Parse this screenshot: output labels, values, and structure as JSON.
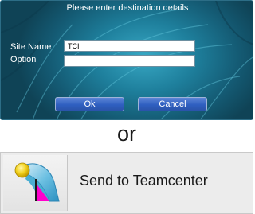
{
  "dialog": {
    "title": "Please enter destination details",
    "site_name_label": "Site Name",
    "site_name_value": "TCI",
    "option_label": "Option",
    "option_value": "",
    "ok_label": "Ok",
    "cancel_label": "Cancel"
  },
  "separator_text": "or",
  "teamcenter_button": {
    "label": "Send to Teamcenter",
    "icon": "send-to-teamcenter-icon"
  },
  "colors": {
    "dialog_background": "#1e7f9c",
    "button_blue": "#2f5fc0",
    "icon_magenta": "#ff00cc",
    "icon_yellow": "#f2d21e",
    "icon_teal": "#3aa7cf"
  }
}
